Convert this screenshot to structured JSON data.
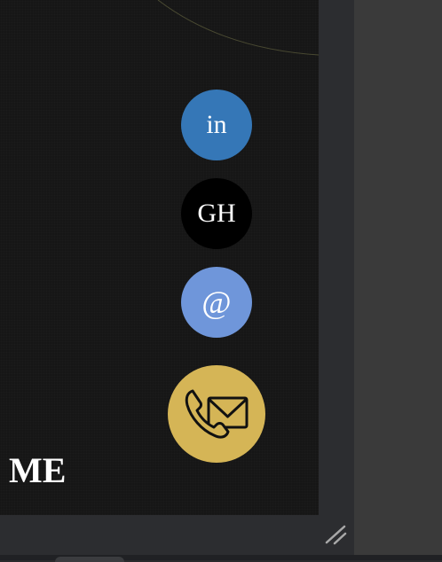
{
  "social": {
    "linkedin": "in",
    "github": "GH",
    "email": "@"
  },
  "contact_icon": "phone-mail-icon",
  "section": {
    "title": "ME"
  },
  "colors": {
    "viewport_bg": "#161616",
    "linkedin": "#3577b7",
    "github": "#000000",
    "email": "#6f96da",
    "contact": "#d5b556",
    "panel": "#3a3a3a",
    "chrome": "#2c2d30"
  }
}
